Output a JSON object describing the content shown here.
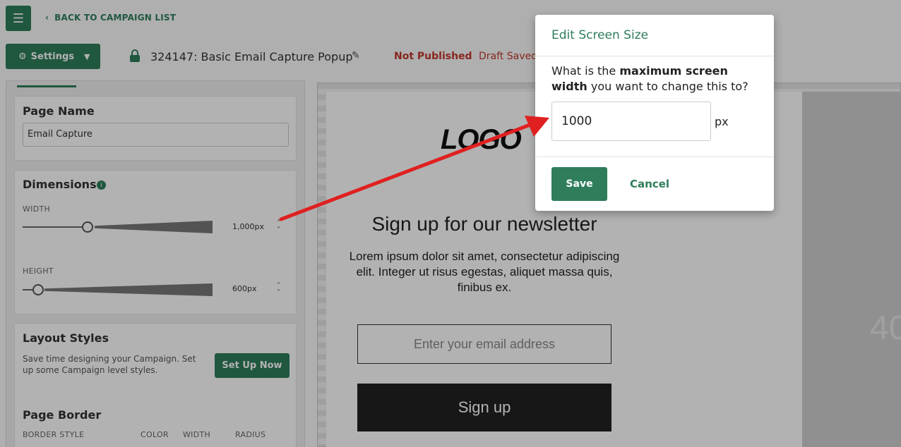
{
  "header": {
    "back_label": "BACK TO CAMPAIGN LIST",
    "settings_label": "Settings",
    "campaign_title": "324147: Basic Email Capture Popup",
    "status": "Not Published",
    "draft_status": "Draft Saved"
  },
  "sidebar": {
    "page_name": {
      "heading": "Page Name",
      "value": "Email Capture"
    },
    "dimensions": {
      "heading": "Dimensions",
      "width_label": "WIDTH",
      "width_value": "1,000px",
      "height_label": "HEIGHT",
      "height_value": "600px"
    },
    "layout_styles": {
      "heading": "Layout Styles",
      "description": "Save time designing your Campaign. Set up some Campaign level styles.",
      "button_label": "Set Up Now"
    },
    "page_border": {
      "heading": "Page Border",
      "border_style_label": "BORDER STYLE",
      "color_label": "COLOR",
      "width_label": "WIDTH",
      "radius_label": "RADIUS"
    }
  },
  "canvas": {
    "logo": "LOGO",
    "heading": "Sign up for our newsletter",
    "body": "Lorem ipsum dolor sit amet, consectetur adipiscing elit. Integer ut risus egestas, aliquet massa quis, finibus ex.",
    "email_placeholder": "Enter your email address",
    "signup_label": "Sign up",
    "side_number": "40"
  },
  "modal": {
    "title": "Edit Screen Size",
    "question_pre": "What is the ",
    "question_bold": "maximum screen width",
    "question_post": " you want to change this to?",
    "input_value": "1000",
    "unit": "px",
    "save_label": "Save",
    "cancel_label": "Cancel"
  },
  "colors": {
    "brand": "#2f7d5b",
    "status_red": "#c0392b",
    "arrow_red": "#e02020"
  }
}
